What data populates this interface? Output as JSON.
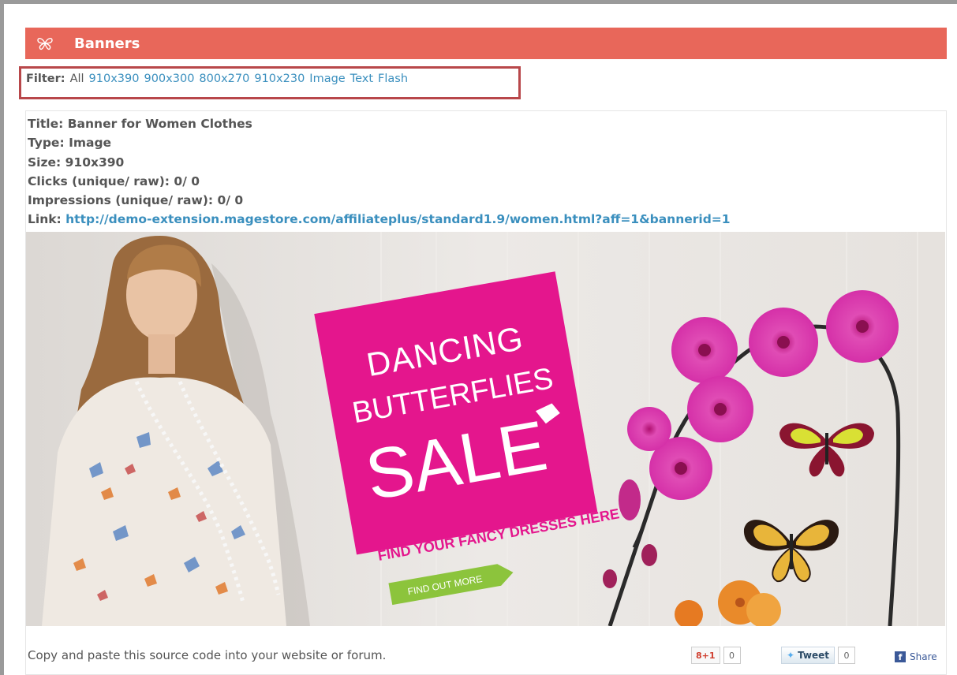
{
  "header": {
    "title": "Banners",
    "icon": "butterfly-icon"
  },
  "filter": {
    "label": "Filter:",
    "options": [
      "All",
      "910x390",
      "900x300",
      "800x270",
      "910x230",
      "Image",
      "Text",
      "Flash"
    ]
  },
  "banner_info": {
    "title_label": "Title:",
    "title": "Banner for Women Clothes",
    "type_label": "Type:",
    "type": "Image",
    "size_label": "Size:",
    "size": "910x390",
    "clicks_label": "Clicks (unique/ raw):",
    "clicks": "0/ 0",
    "impressions_label": "Impressions (unique/ raw):",
    "impressions": "0/ 0",
    "link_label": "Link:",
    "link": "http://demo-extension.magestore.com/affiliateplus/standard1.9/women.html?aff=1&bannerid=1"
  },
  "banner_image": {
    "line1": "DANCING",
    "line2": "BUTTERFLIES",
    "line3": "SALE",
    "tagline": "FIND YOUR FANCY DRESSES HERE",
    "cta": "FIND OUT MORE",
    "colors": {
      "pink": "#e4168d",
      "green": "#8cc43c",
      "orchid": "#d433a8",
      "wall": "#e9e6e3"
    }
  },
  "footer": {
    "instruction": "Copy and paste this source code into your website or forum.",
    "gplus_label": "+1",
    "gplus_count": "0",
    "tweet_label": "Tweet",
    "tweet_count": "0",
    "share_label": "Share"
  },
  "colors": {
    "header_bg": "#e8675a",
    "link": "#3a8fbe",
    "highlight_border": "#b8474a"
  }
}
